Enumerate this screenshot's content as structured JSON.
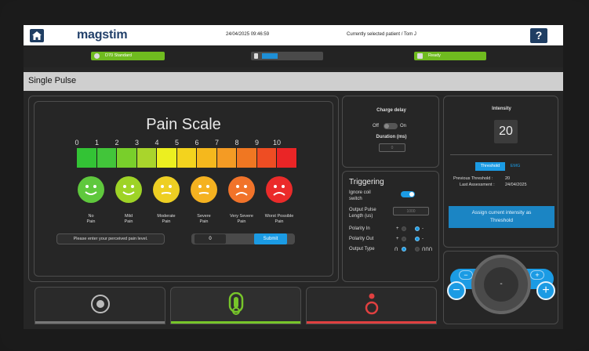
{
  "topbar": {
    "brand": "magstim",
    "datetime": "24/04/2025 09:46:59",
    "patient": "Currently selected patient / Tom J",
    "help_label": "?"
  },
  "statusbar": {
    "coil": "D70 Standard",
    "ready": "Ready",
    "temperature_level": 0.22
  },
  "title": "Single Pulse",
  "pain_scale": {
    "title": "Pain Scale",
    "numbers": [
      "0",
      "1",
      "2",
      "3",
      "4",
      "5",
      "6",
      "7",
      "8",
      "9",
      "10"
    ],
    "bar_colors": [
      "#33c335",
      "#42c53a",
      "#79cf2b",
      "#a9d52c",
      "#ecef20",
      "#f3d31e",
      "#f5b81d",
      "#f49b24",
      "#f07722",
      "#ee4d23",
      "#ea2526"
    ],
    "faces": [
      {
        "label_line1": "No",
        "label_line2": "Pain",
        "color": "#5fc83d",
        "mood": "happy"
      },
      {
        "label_line1": "Mild",
        "label_line2": "Pain",
        "color": "#9ed326",
        "mood": "happy"
      },
      {
        "label_line1": "Moderate",
        "label_line2": "Pain",
        "color": "#eecf23",
        "mood": "neutral"
      },
      {
        "label_line1": "Severe",
        "label_line2": "Pain",
        "color": "#f5b220",
        "mood": "neutral"
      },
      {
        "label_line1": "Very Severe",
        "label_line2": "Pain",
        "color": "#f1732a",
        "mood": "sad"
      },
      {
        "label_line1": "Worst Possible",
        "label_line2": "Pain",
        "color": "#eb2b2a",
        "mood": "sad"
      }
    ],
    "prompt": "Please enter your perceived pain level.",
    "input_value": "0",
    "submit_label": "Submit"
  },
  "charge": {
    "title": "Charge delay",
    "off_label": "Off",
    "on_label": "On",
    "duration_label": "Duration (ms)",
    "duration_value": "0"
  },
  "triggering": {
    "title": "Triggering",
    "ignore_coil": "Ignore coil",
    "ignore_coil2": "switch",
    "pulse_length": "Output Pulse",
    "pulse_length2": "Length (us)",
    "pulse_length_value": "1000",
    "polarity_in": "Polarity In",
    "polarity_out": "Polarity Out",
    "output_type": "Output Type",
    "plus": "+",
    "minus": "-",
    "single_sym": "ꓵ",
    "multi_sym": "ꓵꓵꓵ"
  },
  "intensity": {
    "title": "Intensity",
    "value": "20",
    "threshold_tab": "Threshold",
    "emg_tab": "EMG",
    "prev_threshold_label": "Previous Threshold :",
    "prev_threshold_value": "20",
    "last_assessment_label": "Last Assessment :",
    "last_assessment_value": "24/04/2025",
    "assign_line1": "Assign current intensity as",
    "assign_line2": "Threshold"
  },
  "dial": {
    "minus_small": "−",
    "plus_small": "+",
    "minus_big": "−",
    "plus_big": "+",
    "center": "-"
  },
  "colors": {
    "accent_blue": "#1b9be4",
    "green": "#6fbb1f",
    "red": "#e04040"
  }
}
